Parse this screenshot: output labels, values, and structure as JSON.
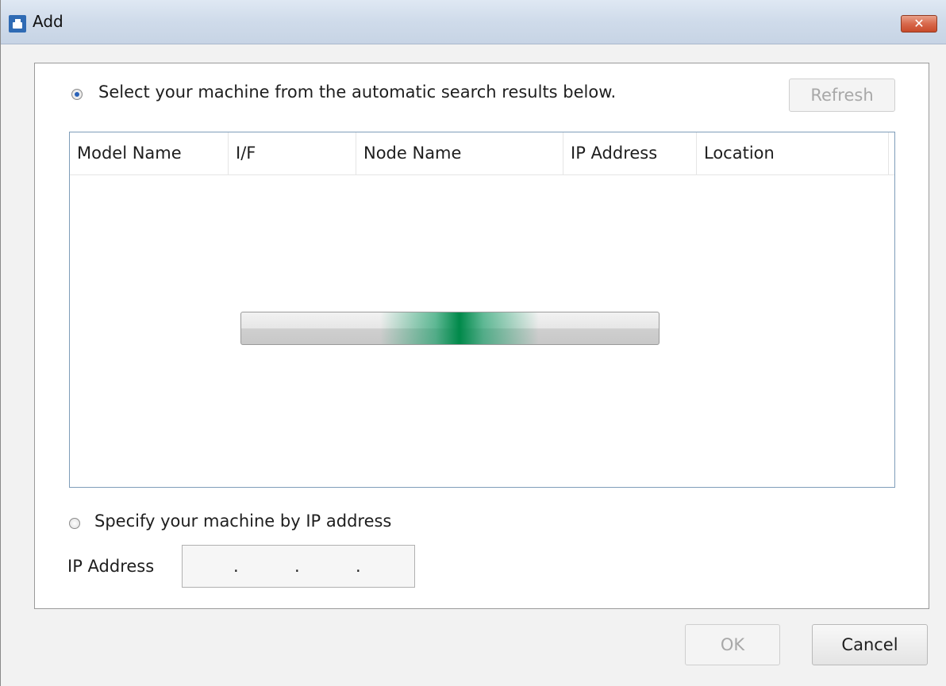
{
  "window": {
    "title": "Add",
    "close_glyph": "✕"
  },
  "auto_search": {
    "label": "Select your machine from the automatic search results  below.",
    "selected": true,
    "refresh_label": "Refresh"
  },
  "results_list": {
    "columns": [
      "Model Name",
      "I/F",
      "Node Name",
      "IP Address",
      "Location"
    ],
    "rows": [],
    "progress_indicator": {
      "state": "searching",
      "color": "#00894a"
    }
  },
  "manual": {
    "label": "Specify your machine by IP address",
    "selected": false,
    "ip_label": "IP Address",
    "ip_separators": [
      ".",
      ".",
      "."
    ]
  },
  "footer": {
    "ok_label": "OK",
    "cancel_label": "Cancel"
  }
}
